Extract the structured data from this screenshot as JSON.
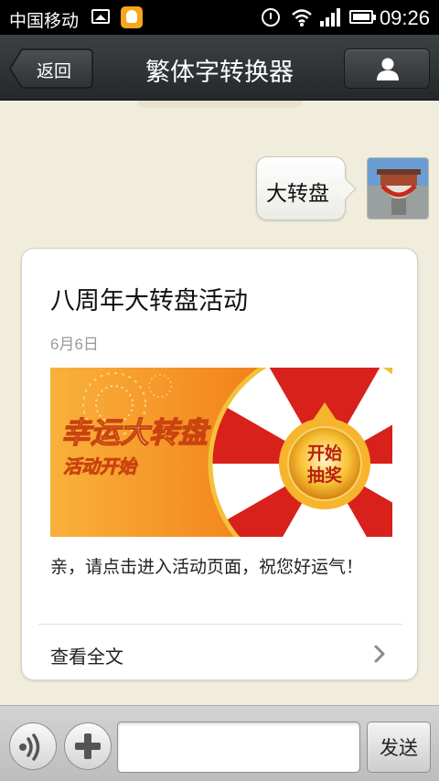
{
  "status_bar": {
    "carrier": "中国移动",
    "time": "09:26",
    "icons": [
      "image-icon",
      "qq-icon",
      "alarm-icon",
      "wifi-icon",
      "signal-icon",
      "battery-icon"
    ]
  },
  "header": {
    "back_label": "返回",
    "title": "繁体字转换器",
    "profile_icon": "person-icon"
  },
  "chat": {
    "outgoing_message": "大转盘",
    "article": {
      "title": "八周年大转盘活动",
      "date": "6月6日",
      "image_text": {
        "headline": "幸运大转盘",
        "subline": "活动开始",
        "center_button_line1": "开始",
        "center_button_line2": "抽奖"
      },
      "description": "亲，请点击进入活动页面，祝您好运气！",
      "read_more": "查看全文"
    }
  },
  "input_bar": {
    "voice_icon": "voice-icon",
    "plus_icon": "plus-icon",
    "input_value": "",
    "send_label": "发送"
  },
  "colors": {
    "header_bg": "#2e3235",
    "chat_bg": "#f0eddd",
    "banner_orange": "#f07a1a",
    "wheel_red": "#d8211a"
  }
}
